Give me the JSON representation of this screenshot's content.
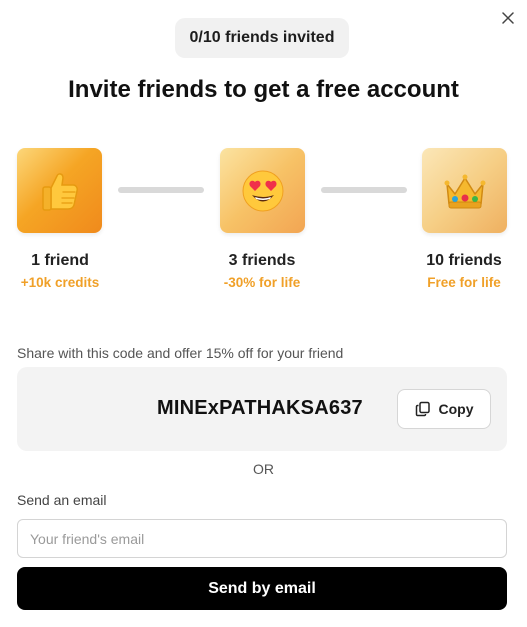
{
  "counter": {
    "text": "0/10 friends invited"
  },
  "title": "Invite friends to get a free account",
  "tiers": [
    {
      "icon": "thumbs-up-icon",
      "name": "1 friend",
      "reward": "+10k credits"
    },
    {
      "icon": "heart-eyes-face-icon",
      "name": "3 friends",
      "reward": "-30% for life"
    },
    {
      "icon": "crown-icon",
      "name": "10 friends",
      "reward": "Free for life"
    }
  ],
  "share": {
    "label": "Share with this code and offer 15% off for your friend",
    "code": "MINExPATHAKSA637",
    "copy_label": "Copy"
  },
  "divider": "OR",
  "email": {
    "label": "Send an email",
    "placeholder": "Your friend's email",
    "value": "",
    "send_label": "Send by email"
  },
  "colors": {
    "accent": "#f0a028",
    "button_bg": "#000000",
    "code_box_bg": "#f3f3f3"
  }
}
